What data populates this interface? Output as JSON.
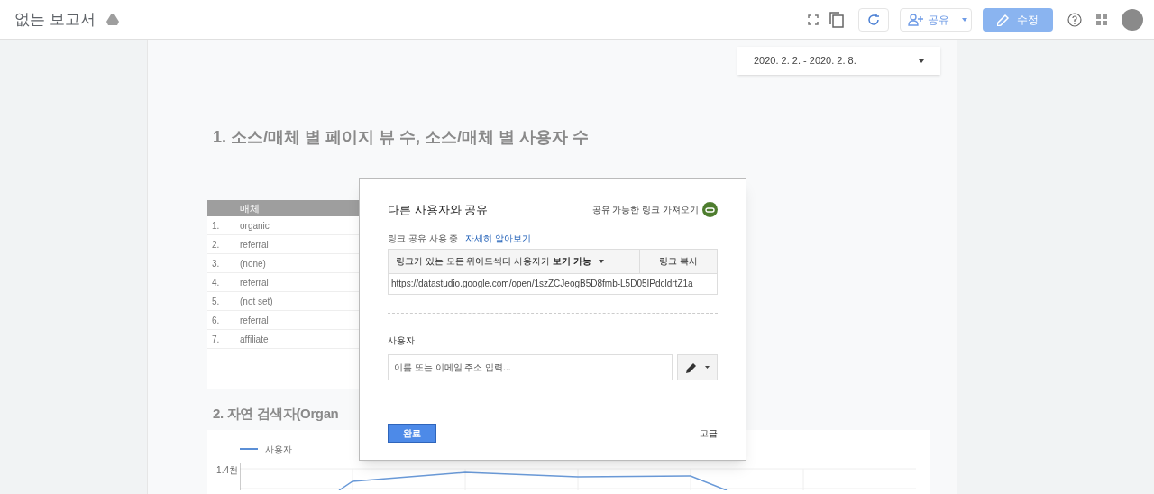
{
  "header": {
    "title": "없는 보고서",
    "share_label": "공유",
    "edit_label": "수정"
  },
  "report": {
    "date_range": "2020. 2. 2. - 2020. 2. 8.",
    "section_1_title": "1. 소스/매체 별 페이지 뷰 수, 소스/매체 별 사용자 수",
    "table": {
      "columns": [
        "매체"
      ],
      "rows": [
        {
          "index": "1.",
          "medium": "organic"
        },
        {
          "index": "2.",
          "medium": "referral"
        },
        {
          "index": "3.",
          "medium": "(none)"
        },
        {
          "index": "4.",
          "medium": "referral"
        },
        {
          "index": "5.",
          "medium": "(not set)"
        },
        {
          "index": "6.",
          "medium": "referral"
        },
        {
          "index": "7.",
          "medium": "affiliate"
        }
      ]
    },
    "section_2_title": "2. 자연 검색자(Organ",
    "chart": {
      "legend": "사용자",
      "y_tick": "1.4천"
    }
  },
  "dialog": {
    "title": "다른 사용자와 공유",
    "get_link": "공유 가능한 링크 가져오기",
    "link_status": "링크 공유 사용 중",
    "learn_more": "자세히 알아보기",
    "access_prefix": "링크가 있는 모든 위어드섹터 사용자가",
    "access_level": "보기 가능",
    "copy_link": "링크 복사",
    "url": "https://datastudio.google.com/open/1szZCJeogB5D8fmb-L5D05IPdcldrtZ1a",
    "people_label": "사용자",
    "people_placeholder": "이름 또는 이메일 주소 입력...",
    "done": "완료",
    "advanced": "고급"
  }
}
